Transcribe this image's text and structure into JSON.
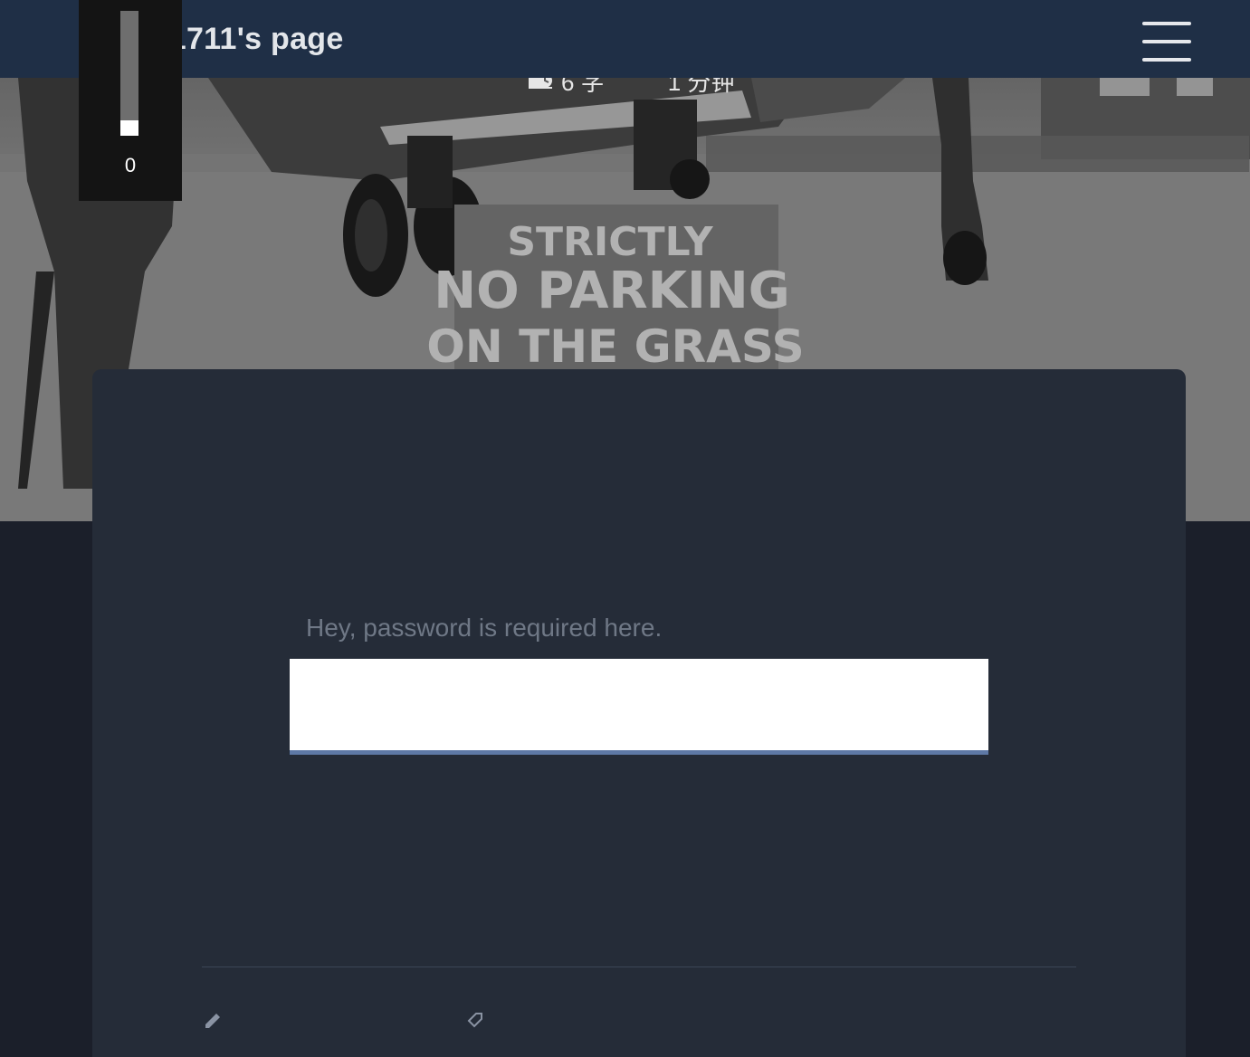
{
  "navbar": {
    "site_title": "Brook1711's page",
    "menu_icon": "hamburger-menu-icon"
  },
  "hero": {
    "sign_text": [
      "STRICTLY",
      "NO PARKING",
      "ON THE  GRASS"
    ],
    "meta": {
      "word_count": "6 字",
      "read_time": "1 分钟",
      "word_count_icon": "bar-chart-icon",
      "read_time_icon": "clock-icon"
    }
  },
  "progress": {
    "value_text": "0",
    "fraction": 0.12
  },
  "post": {
    "password_label": "Hey, password is required here.",
    "password_value": ""
  },
  "footer": {
    "icons": [
      "edit-icon",
      "tag-icon"
    ]
  }
}
